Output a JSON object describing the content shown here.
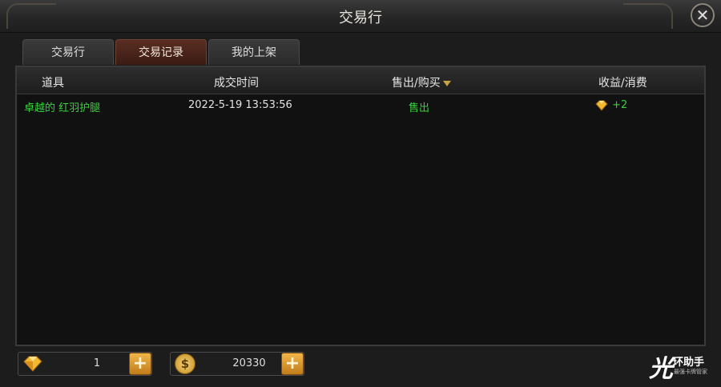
{
  "window": {
    "title": "交易行",
    "close_icon": "close-icon"
  },
  "tabs": [
    {
      "label": "交易行",
      "active": false
    },
    {
      "label": "交易记录",
      "active": true
    },
    {
      "label": "我的上架",
      "active": false
    }
  ],
  "table": {
    "columns": [
      {
        "label": "道具"
      },
      {
        "label": "成交时间"
      },
      {
        "label": "售出/购买",
        "sort_icon": "sort-down-icon"
      },
      {
        "label": "收益/消费"
      }
    ],
    "rows": [
      {
        "item": "卓越的 红羽护腿",
        "time": "2022-5-19 13:53:56",
        "type": "售出",
        "amount_icon": "gem-icon",
        "amount": "+2"
      }
    ]
  },
  "currency": {
    "gems": {
      "icon": "gem-icon",
      "value": "1"
    },
    "gold": {
      "icon": "coin-icon",
      "value": "20330",
      "symbol": "$"
    }
  },
  "watermark": {
    "mark": "光",
    "title": "环助手",
    "subtitle": "最强卡牌管家"
  },
  "colors": {
    "green_text": "#37d23c",
    "active_tab": "#5a2e22",
    "plus_button": "#e0a03a"
  }
}
